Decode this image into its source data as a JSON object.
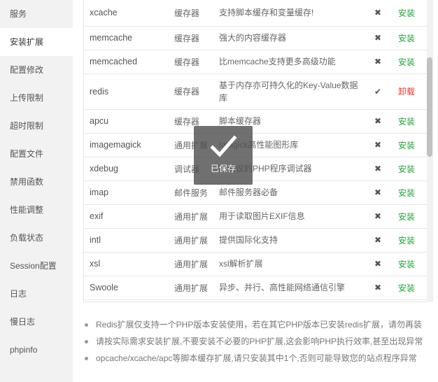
{
  "sidebar": {
    "items": [
      {
        "label": "服务"
      },
      {
        "label": "安装扩展"
      },
      {
        "label": "配置修改"
      },
      {
        "label": "上传限制"
      },
      {
        "label": "超时限制"
      },
      {
        "label": "配置文件"
      },
      {
        "label": "禁用函数"
      },
      {
        "label": "性能调整"
      },
      {
        "label": "负载状态"
      },
      {
        "label": "Session配置"
      },
      {
        "label": "日志"
      },
      {
        "label": "慢日志"
      },
      {
        "label": "phpinfo"
      }
    ]
  },
  "extensions": [
    {
      "name": "xcache",
      "type": "缓存器",
      "desc": "支持脚本缓存和变量缓存!",
      "status": "✖",
      "action": "安装"
    },
    {
      "name": "memcache",
      "type": "缓存器",
      "desc": "强大的内容缓存器",
      "status": "✖",
      "action": "安装"
    },
    {
      "name": "memcached",
      "type": "缓存器",
      "desc": "比memcache支持更多高级功能",
      "status": "✖",
      "action": "安装"
    },
    {
      "name": "redis",
      "type": "缓存器",
      "desc": "基于内存亦可持久化的Key-Value数据库",
      "status": "✔",
      "action": "卸载"
    },
    {
      "name": "apcu",
      "type": "缓存器",
      "desc": "脚本缓存器",
      "status": "✖",
      "action": "安装"
    },
    {
      "name": "imagemagick",
      "type": "通用扩展",
      "desc": "Imagick高性能图形库",
      "status": "✖",
      "action": "安装"
    },
    {
      "name": "xdebug",
      "type": "调试器",
      "desc": "不建议的PHP程序调试器",
      "status": "✖",
      "action": "安装"
    },
    {
      "name": "imap",
      "type": "邮件服务",
      "desc": "邮件服务器必备",
      "status": "✖",
      "action": "安装"
    },
    {
      "name": "exif",
      "type": "通用扩展",
      "desc": "用于读取图片EXIF信息",
      "status": "✖",
      "action": "安装"
    },
    {
      "name": "intl",
      "type": "通用扩展",
      "desc": "提供国际化支持",
      "status": "✖",
      "action": "安装"
    },
    {
      "name": "xsl",
      "type": "通用扩展",
      "desc": "xsl解析扩展",
      "status": "✖",
      "action": "安装"
    },
    {
      "name": "Swoole",
      "type": "通用扩展",
      "desc": "异步、并行、高性能网络通信引擎",
      "status": "✖",
      "action": "安装"
    }
  ],
  "tips": [
    "Redis扩展仅支持一个PHP版本安装使用，若在其它PHP版本已安装redis扩展，请勿再装",
    "请按实际需求安装扩展,不要安装不必要的PHP扩展,这会影响PHP执行效率,甚至出现异常",
    "opcache/xcache/apc等脚本缓存扩展,请只安装其中1个,否则可能导致您的站点程序异常"
  ],
  "toast": {
    "message": "已保存"
  },
  "colors": {
    "install": "#20a53a",
    "uninstall": "#ee3333",
    "toast_bg": "#505050"
  }
}
